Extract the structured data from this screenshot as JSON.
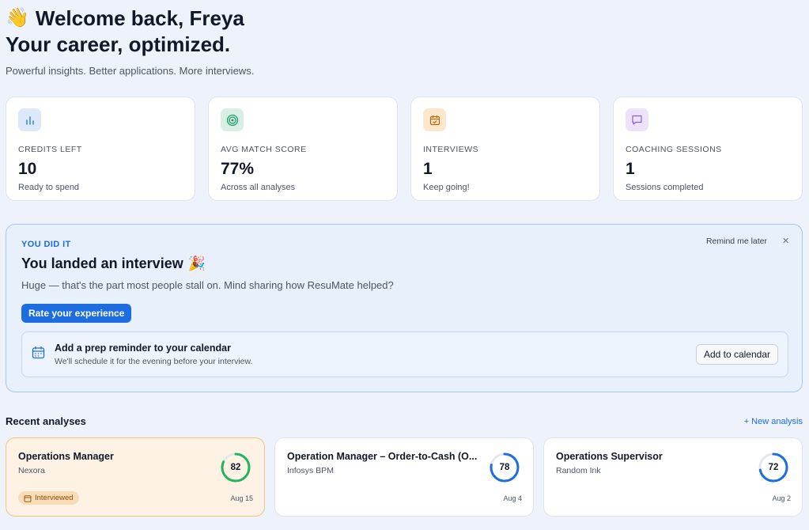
{
  "header": {
    "wave_emoji": "👋",
    "welcome": "Welcome back, Freya",
    "headline": "Your career, optimized.",
    "tagline": "Powerful insights. Better applications. More interviews."
  },
  "stats": [
    {
      "icon": "bar-chart-icon",
      "label": "CREDITS LEFT",
      "value": "10",
      "sub": "Ready to spend",
      "icon_bg": "#dbe9f8",
      "icon_color": "#2b7bd6"
    },
    {
      "icon": "target-icon",
      "label": "AVG MATCH SCORE",
      "value": "77%",
      "sub": "Across all analyses",
      "icon_bg": "#d9efe6",
      "icon_color": "#1f9d67"
    },
    {
      "icon": "calendar-check-icon",
      "label": "INTERVIEWS",
      "value": "1",
      "sub": "Keep going!",
      "icon_bg": "#fbe7cc",
      "icon_color": "#b66a10"
    },
    {
      "icon": "chat-bubble-icon",
      "label": "COACHING SESSIONS",
      "value": "1",
      "sub": "Sessions completed",
      "icon_bg": "#ece3fa",
      "icon_color": "#8b5cd6"
    }
  ],
  "banner": {
    "eyebrow": "YOU DID IT",
    "title": "You landed an interview",
    "title_emoji": "🎉",
    "description": "Huge — that's the part most people stall on. Mind sharing how ResuMate helped?",
    "rate_button": "Rate your experience",
    "remind_later": "Remind me later",
    "close": "×",
    "reminder": {
      "title": "Add a prep reminder to your calendar",
      "subtitle": "We'll schedule it for the evening before your interview.",
      "button": "Add to calendar"
    }
  },
  "recent": {
    "title": "Recent analyses",
    "new_link": "+ New analysis",
    "items": [
      {
        "title": "Operations Manager",
        "company": "Nexora",
        "score": "82",
        "score_value": 82,
        "date": "Aug 15",
        "badge": "Interviewed",
        "ring_color": "#22b35e"
      },
      {
        "title": "Operation Manager – Order-to-Cash (O...",
        "company": "Infosys BPM",
        "score": "78",
        "score_value": 78,
        "date": "Aug 4",
        "ring_color": "#1d6ce0"
      },
      {
        "title": "Operations Supervisor",
        "company": "Random Ink",
        "score": "72",
        "score_value": 72,
        "date": "Aug 2",
        "ring_color": "#1d6ce0"
      }
    ]
  },
  "colors": {
    "accent": "#1d6ce0",
    "background": "#eef3fb"
  }
}
